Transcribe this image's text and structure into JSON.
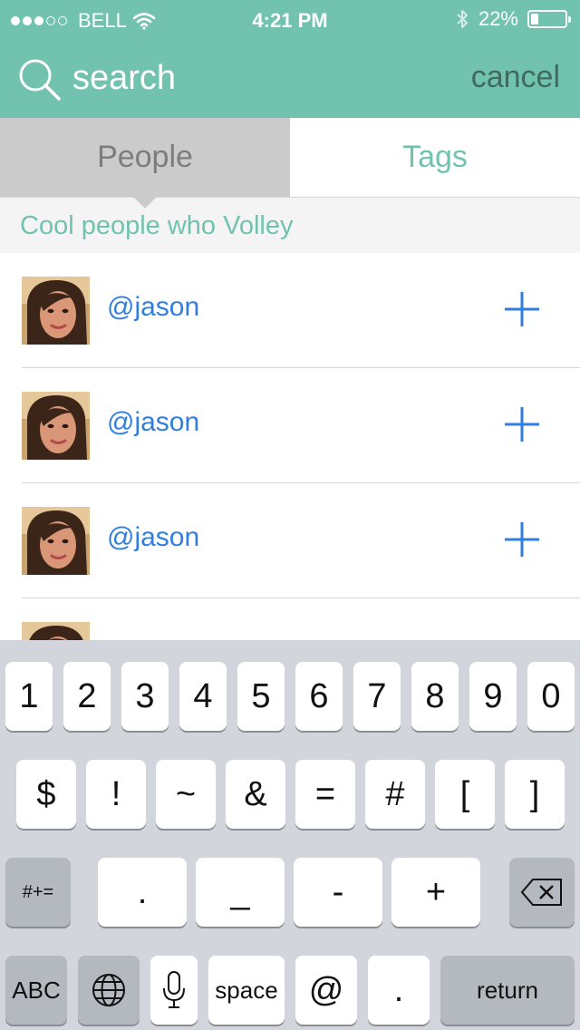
{
  "status_bar": {
    "carrier": "BELL",
    "time": "4:21 PM",
    "battery": "22%",
    "battery_level": 0.22,
    "signal_bars_filled": 3,
    "signal_bars_total": 5
  },
  "search": {
    "placeholder": "search",
    "cancel_label": "cancel"
  },
  "tabs": [
    {
      "label": "People",
      "selected": true
    },
    {
      "label": "Tags",
      "selected": false
    }
  ],
  "section_title": "Cool people who Volley",
  "users": [
    {
      "handle": "@jason"
    },
    {
      "handle": "@jason"
    },
    {
      "handle": "@jason"
    },
    {
      "handle": ""
    }
  ],
  "keyboard": {
    "row1": [
      "1",
      "2",
      "3",
      "4",
      "5",
      "6",
      "7",
      "8",
      "9",
      "0"
    ],
    "row2": [
      "$",
      "!",
      "~",
      "&",
      "=",
      "#",
      "[",
      "]"
    ],
    "row3": [
      "#+=",
      ".",
      "_",
      "-",
      "+"
    ],
    "row4": [
      "ABC",
      "space",
      "@",
      ".",
      "return"
    ]
  },
  "colors": {
    "accent": "#72c2b0",
    "link": "#2f7ee0",
    "cancel": "#3f6a5f"
  },
  "icons": [
    "search-icon",
    "wifi-icon",
    "bluetooth-icon",
    "battery-icon",
    "plus-icon",
    "globe-icon",
    "microphone-icon",
    "backspace-icon"
  ]
}
